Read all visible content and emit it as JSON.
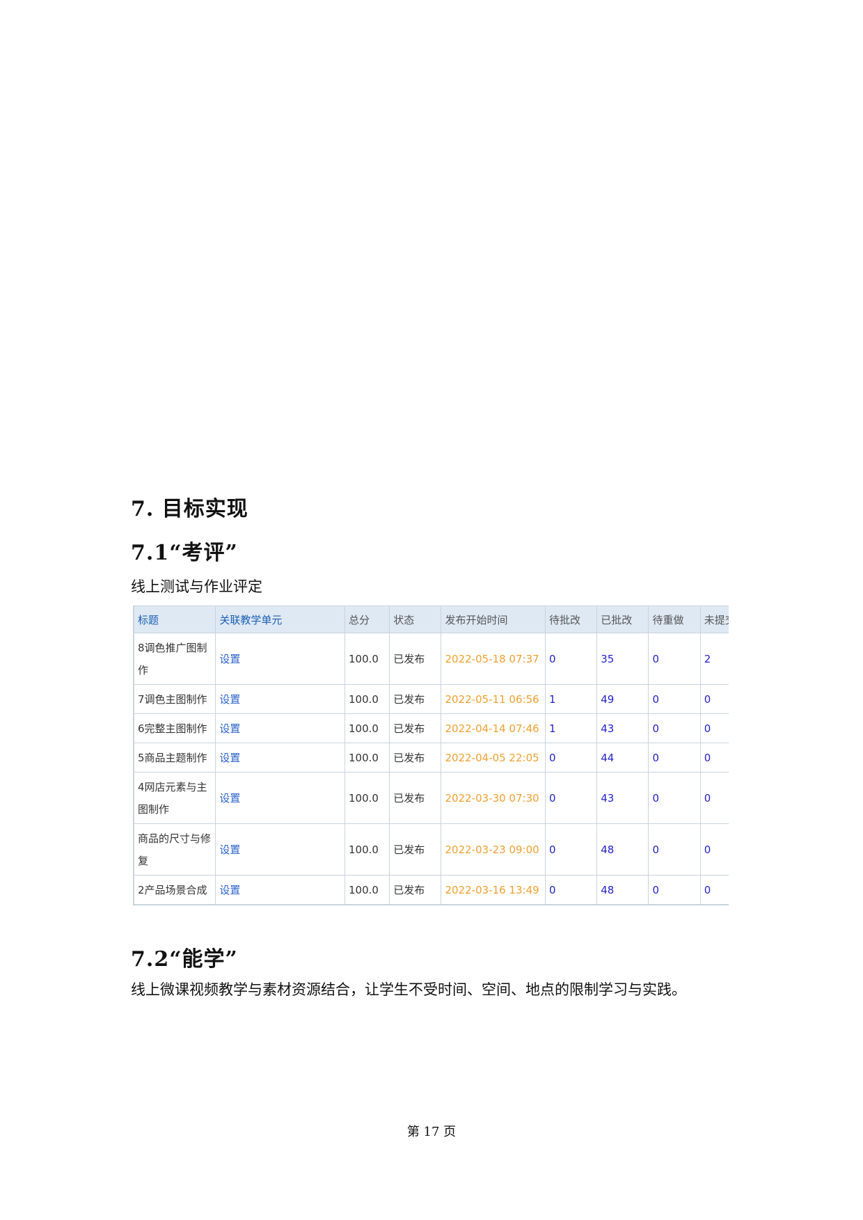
{
  "sections": {
    "h1": "7. 目标实现",
    "s1_title": "7.1“考评”",
    "s1_text": "线上测试与作业评定",
    "s2_title": "7.2“能学”",
    "s2_text": "线上微课视频教学与素材资源结合，让学生不受时间、空间、地点的限制学习与实践。"
  },
  "table": {
    "headers": [
      "标题",
      "关联教学单元",
      "总分",
      "状态",
      "发布开始时间",
      "待批改",
      "已批改",
      "待重做",
      "未提交"
    ],
    "rows": [
      {
        "title": "8调色推广图制作",
        "link": "设置",
        "score": "100.0",
        "status": "已发布",
        "time": "2022-05-18 07:37",
        "pending": "0",
        "graded": "35",
        "redo": "0",
        "unsubmitted": "2"
      },
      {
        "title": "7调色主图制作",
        "link": "设置",
        "score": "100.0",
        "status": "已发布",
        "time": "2022-05-11 06:56",
        "pending": "1",
        "graded": "49",
        "redo": "0",
        "unsubmitted": "0"
      },
      {
        "title": "6完整主图制作",
        "link": "设置",
        "score": "100.0",
        "status": "已发布",
        "time": "2022-04-14 07:46",
        "pending": "1",
        "graded": "43",
        "redo": "0",
        "unsubmitted": "0"
      },
      {
        "title": "5商品主题制作",
        "link": "设置",
        "score": "100.0",
        "status": "已发布",
        "time": "2022-04-05 22:05",
        "pending": "0",
        "graded": "44",
        "redo": "0",
        "unsubmitted": "0"
      },
      {
        "title": "4网店元素与主图制作",
        "link": "设置",
        "score": "100.0",
        "status": "已发布",
        "time": "2022-03-30 07:30",
        "pending": "0",
        "graded": "43",
        "redo": "0",
        "unsubmitted": "0"
      },
      {
        "title": "商品的尺寸与修复",
        "link": "设置",
        "score": "100.0",
        "status": "已发布",
        "time": "2022-03-23 09:00",
        "pending": "0",
        "graded": "48",
        "redo": "0",
        "unsubmitted": "0"
      },
      {
        "title": "2产品场景合成",
        "link": "设置",
        "score": "100.0",
        "status": "已发布",
        "time": "2022-03-16 13:49",
        "pending": "0",
        "graded": "48",
        "redo": "0",
        "unsubmitted": "0"
      }
    ]
  },
  "footer": {
    "page_label": "第 17 页"
  }
}
